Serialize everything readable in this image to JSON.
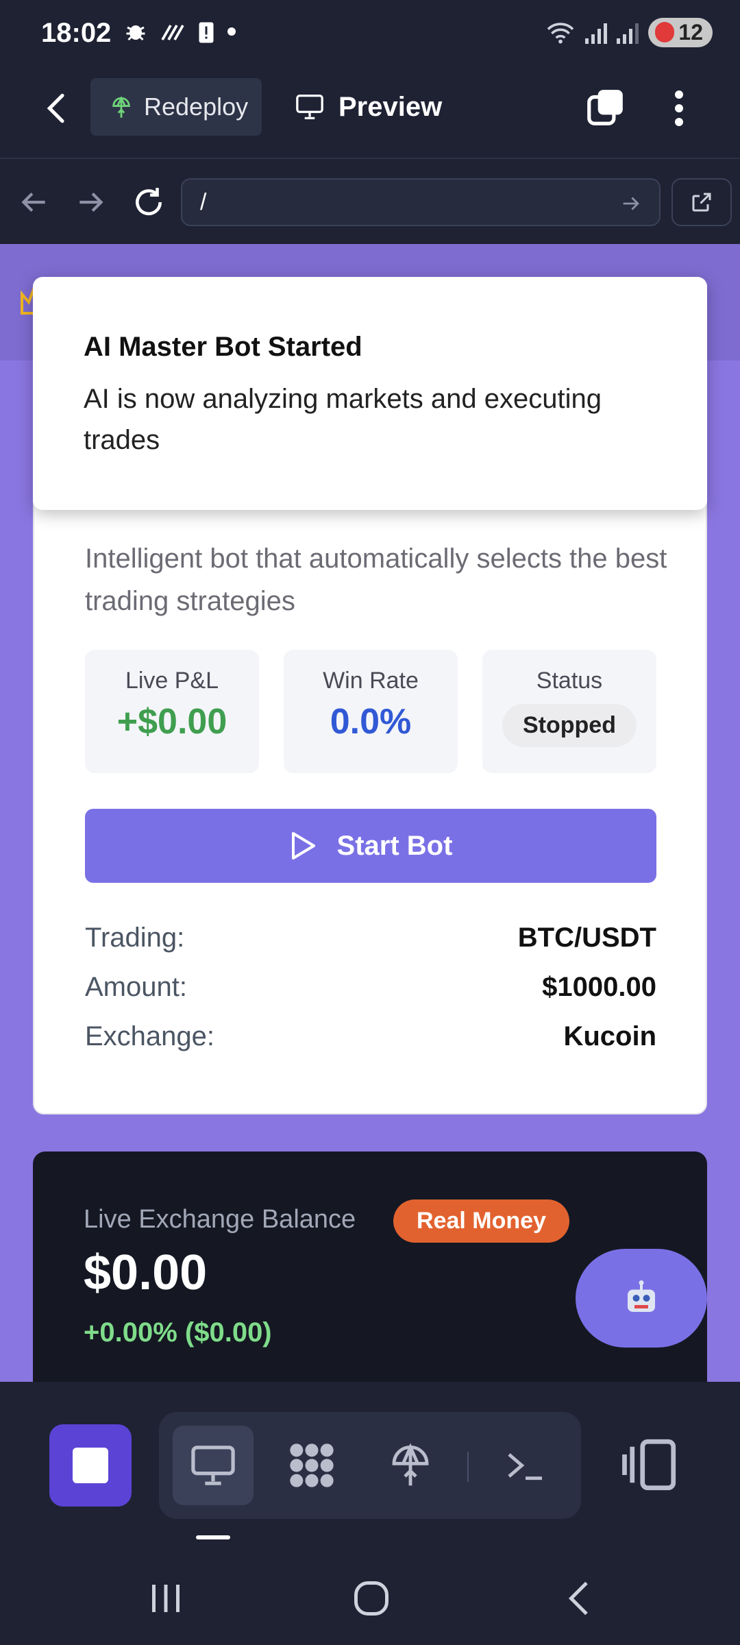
{
  "status_bar": {
    "time": "18:02",
    "battery": "12"
  },
  "app_bar": {
    "redeploy_label": "Redeploy",
    "preview_label": "Preview"
  },
  "url_bar": {
    "value": "/"
  },
  "toast": {
    "title": "AI Master Bot Started",
    "message": "AI is now analyzing markets and executing trades"
  },
  "bot_card": {
    "description": "Intelligent bot that automatically selects the best trading strategies",
    "stats": [
      {
        "label": "Live P&L",
        "value": "+$0.00",
        "color": "#3f9e4f"
      },
      {
        "label": "Win Rate",
        "value": "0.0%",
        "color": "#3159d6"
      },
      {
        "label": "Status",
        "value": "Stopped"
      }
    ],
    "start_button_label": "Start Bot",
    "details": [
      {
        "key": "Trading:",
        "value": "BTC/USDT"
      },
      {
        "key": "Amount:",
        "value": "$1000.00"
      },
      {
        "key": "Exchange:",
        "value": "Kucoin"
      }
    ]
  },
  "balance_card": {
    "label": "Live Exchange Balance",
    "badge": "Real Money",
    "amount": "$0.00",
    "change": "+0.00% ($0.00)"
  },
  "colors": {
    "accent": "#7a70e6",
    "page_bg": "#8a76e0",
    "app_bg": "#1e2233"
  }
}
